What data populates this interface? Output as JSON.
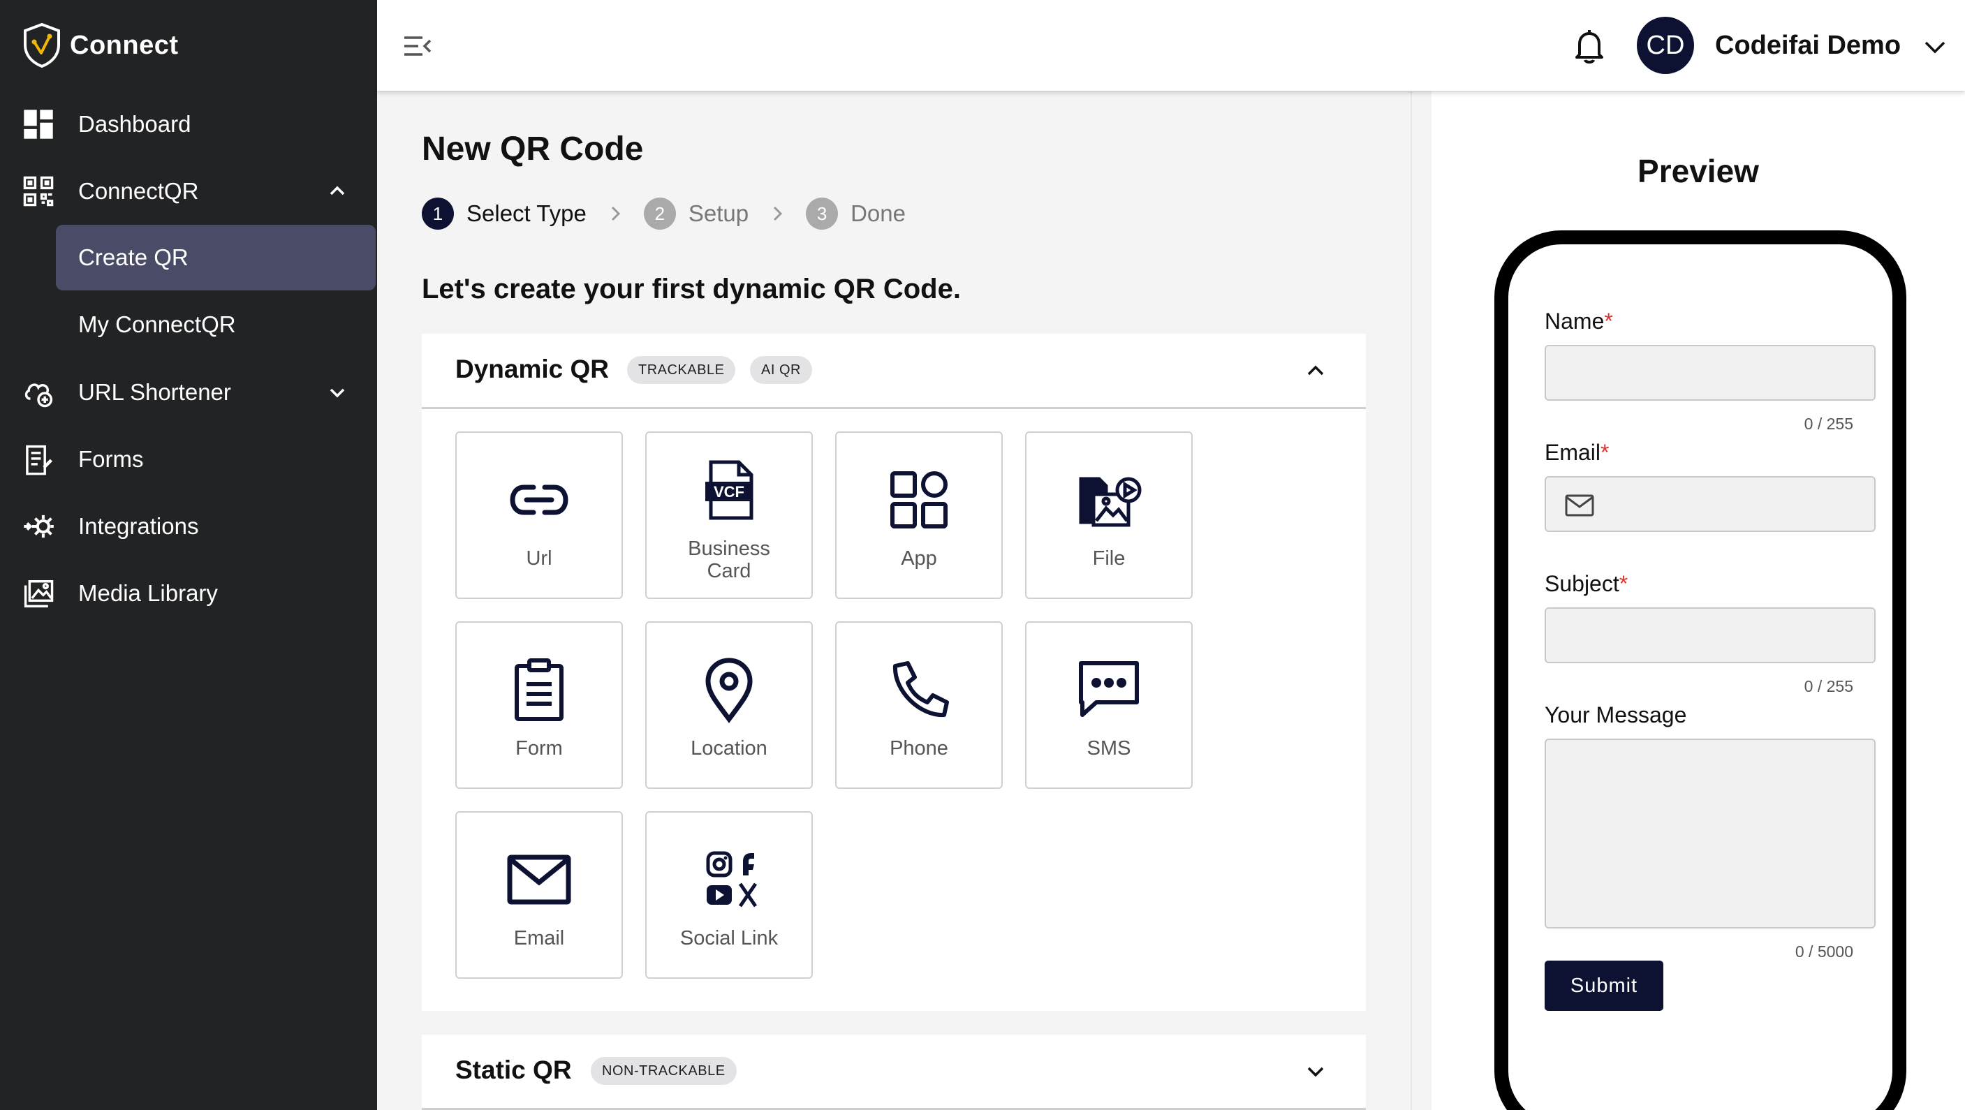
{
  "sidebar": {
    "brand": "Connect",
    "items": [
      {
        "label": "Dashboard"
      },
      {
        "label": "ConnectQR"
      },
      {
        "label": "Create QR"
      },
      {
        "label": "My ConnectQR"
      },
      {
        "label": "URL Shortener"
      },
      {
        "label": "Forms"
      },
      {
        "label": "Integrations"
      },
      {
        "label": "Media Library"
      }
    ]
  },
  "topbar": {
    "avatar_initials": "CD",
    "user_name": "Codeifai Demo"
  },
  "main": {
    "title": "New QR Code",
    "steps": [
      {
        "num": "1",
        "label": "Select Type"
      },
      {
        "num": "2",
        "label": "Setup"
      },
      {
        "num": "3",
        "label": "Done"
      }
    ],
    "subheading": "Let's create your first dynamic QR Code.",
    "dynamic": {
      "title": "Dynamic QR",
      "badges": [
        "TRACKABLE",
        "AI QR"
      ],
      "types": [
        {
          "label": "Url",
          "icon": "link-icon"
        },
        {
          "label": "Business Card",
          "icon": "vcf-icon"
        },
        {
          "label": "App",
          "icon": "app-grid-icon"
        },
        {
          "label": "File",
          "icon": "file-media-icon"
        },
        {
          "label": "Form",
          "icon": "clipboard-icon"
        },
        {
          "label": "Location",
          "icon": "location-pin-icon"
        },
        {
          "label": "Phone",
          "icon": "phone-icon"
        },
        {
          "label": "SMS",
          "icon": "sms-icon"
        },
        {
          "label": "Email",
          "icon": "envelope-icon"
        },
        {
          "label": "Social Link",
          "icon": "social-icons"
        }
      ]
    },
    "static": {
      "title": "Static QR",
      "badge": "NON-TRACKABLE"
    }
  },
  "preview": {
    "title": "Preview",
    "fields": [
      {
        "label": "Name",
        "required": "*",
        "counter": "0 / 255"
      },
      {
        "label": "Email",
        "required": "*"
      },
      {
        "label": "Subject",
        "required": "*",
        "counter": "0 / 255"
      },
      {
        "label": "Your Message",
        "counter": "0 / 5000"
      }
    ],
    "submit": "Submit"
  },
  "colors": {
    "sidebar_bg": "#222324",
    "active_nav": "#4a4b66",
    "primary": "#0d1233",
    "required": "#e0322a"
  }
}
